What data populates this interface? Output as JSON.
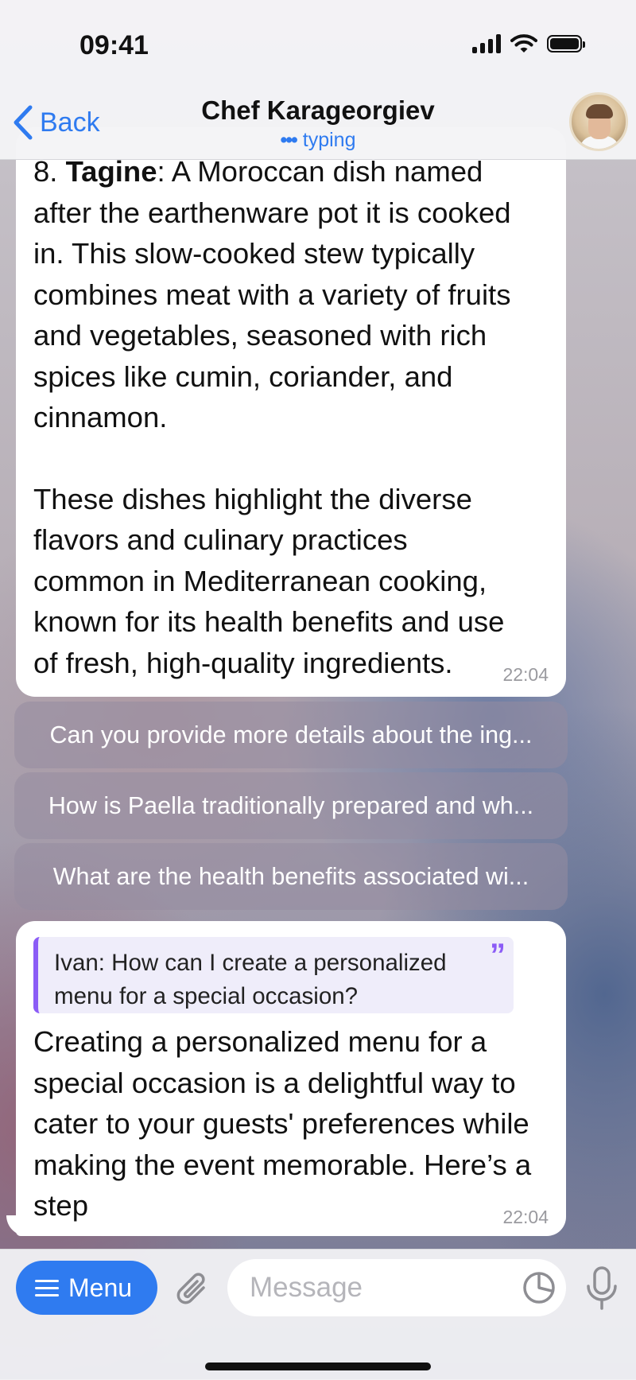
{
  "status_bar": {
    "time": "09:41"
  },
  "header": {
    "back_label": "Back",
    "title": "Chef Karageorgiev",
    "status_dots": "•••",
    "status_text": "typing"
  },
  "messages": [
    {
      "number": "8. ",
      "bold": "Tagine",
      "text": ": A Moroccan dish named\nafter the earthenware pot it is cooked\nin. This slow-cooked stew typically\ncombines meat with a variety of fruits\nand vegetables, seasoned with rich\nspices like cumin, coriander, and\ncinnamon.",
      "paragraph2": "These dishes highlight the diverse\nflavors and culinary practices\ncommon in Mediterranean cooking,\nknown for its health benefits and use\nof fresh, high-quality ingredients.",
      "time": "22:04"
    },
    {
      "reply": "Ivan: How can I create a personalized menu for a special occasion?",
      "quote_mark": "”",
      "text": "Creating a personalized menu for a special occasion is a delightful way to cater to your guests' preferences while making the event memorable. Here’s a step",
      "time": "22:04"
    }
  ],
  "quick_replies": [
    "Can you provide more details about the ing...",
    "How is Paella traditionally prepared and wh...",
    "What are the health benefits associated wi..."
  ],
  "input_bar": {
    "menu_label": "Menu",
    "placeholder": "Message"
  }
}
